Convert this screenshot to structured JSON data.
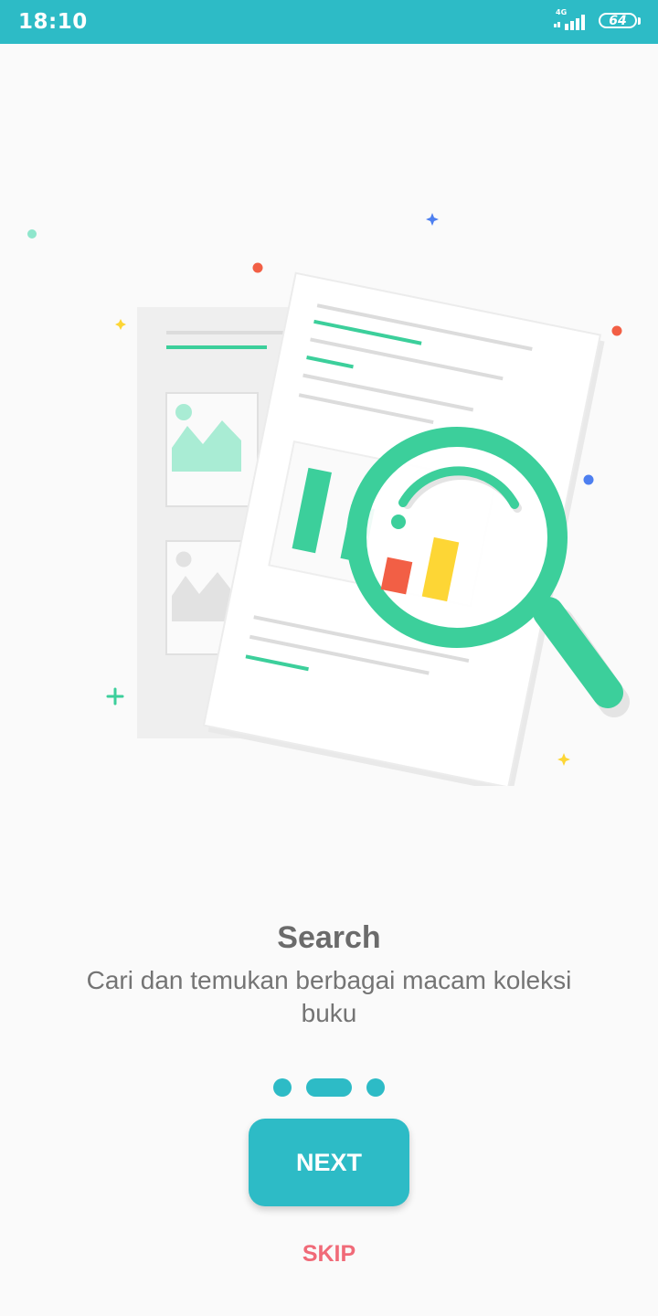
{
  "status_bar": {
    "time": "18:10",
    "network": "4G",
    "battery": "64"
  },
  "onboarding": {
    "title": "Search",
    "description": "Cari dan temukan berbagai macam koleksi buku",
    "page_count": 3,
    "active_page": 2,
    "illustration_icon": "document-search-magnifier-illustration"
  },
  "actions": {
    "next_label": "NEXT",
    "skip_label": "SKIP"
  },
  "colors": {
    "primary": "#2dbbc6",
    "accent_green": "#3ccf9b",
    "skip_red": "#f06a78",
    "bar_red": "#f25f45",
    "bar_yellow": "#fdd635"
  }
}
